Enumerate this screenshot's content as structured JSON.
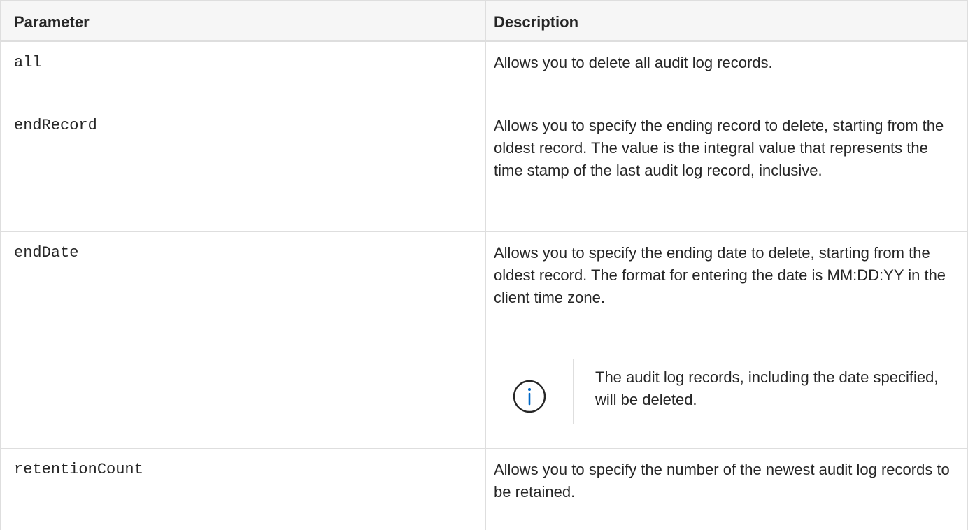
{
  "table": {
    "headers": {
      "parameter": "Parameter",
      "description": "Description"
    },
    "rows": [
      {
        "parameter": "all",
        "description": "Allows you to delete all audit log records."
      },
      {
        "parameter": "endRecord",
        "description": "Allows you to specify the ending record to delete, starting from the oldest record. The value is the integral value that represents the time stamp of the last audit log record, inclusive."
      },
      {
        "parameter": "endDate",
        "description": "Allows you to specify the ending date to delete, starting from the oldest record. The format for entering the date is MM:DD:YY in the client time zone.",
        "note": {
          "icon": "info-icon",
          "text": "The audit log records, including the date specified, will be deleted."
        }
      },
      {
        "parameter": "retentionCount",
        "description": "Allows you to specify the number of the newest audit log records to be retained."
      }
    ]
  },
  "colors": {
    "border": "#dedede",
    "header_bg": "#f6f6f6",
    "text": "#262626",
    "note_icon": "#0067c5"
  }
}
